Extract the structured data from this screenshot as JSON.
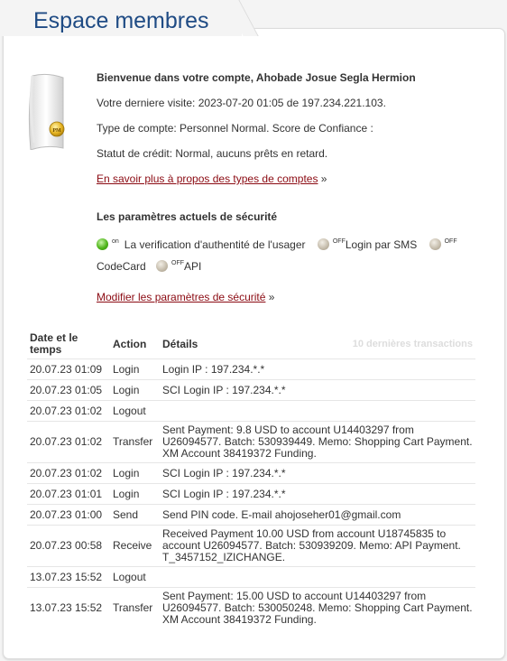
{
  "page": {
    "title": "Espace membres"
  },
  "account": {
    "welcome": "Bienvenue dans votre compte, Ahobade Josue Segla Hermion",
    "last_visit": "Votre derniere visite: 2023-07-20 01:05 de 197.234.221.103.",
    "account_type": "Type de compte: Personnel Normal. Score de Confiance :",
    "credit_status": "Statut de crédit: Normal, aucuns prêts en retard.",
    "learn_more_link": "En savoir plus à propos des types de comptes",
    "learn_more_suffix": " »",
    "badge_text": "PM"
  },
  "security": {
    "heading": "Les paramètres actuels de sécurité",
    "items": [
      {
        "label": "La verification d'authentité de l'usager",
        "state": "on"
      },
      {
        "label": "Login par SMS",
        "state": "OFF"
      },
      {
        "label": "CodeCard",
        "state": "OFF"
      },
      {
        "label": "API",
        "state": "OFF"
      }
    ],
    "modify_link": "Modifier les paramètres de sécurité",
    "modify_suffix": " »",
    "colors": {
      "on": "#4fb51a",
      "off": "#c3baa9"
    }
  },
  "transactions": {
    "headers": {
      "date": "Date et le temps",
      "action": "Action",
      "details": "Détails",
      "count": "10 dernières transactions"
    },
    "rows": [
      {
        "date": "20.07.23 01:09",
        "action": "Login",
        "details": "Login IP : 197.234.*.*"
      },
      {
        "date": "20.07.23 01:05",
        "action": "Login",
        "details": "SCI Login IP : 197.234.*.*"
      },
      {
        "date": "20.07.23 01:02",
        "action": "Logout",
        "details": ""
      },
      {
        "date": "20.07.23 01:02",
        "action": "Transfer",
        "details": "Sent Payment: 9.8 USD to account U14403297 from U26094577. Batch: 530939449. Memo: Shopping Cart Payment. XM Account 38419372 Funding."
      },
      {
        "date": "20.07.23 01:02",
        "action": "Login",
        "details": "SCI Login IP : 197.234.*.*"
      },
      {
        "date": "20.07.23 01:01",
        "action": "Login",
        "details": "SCI Login IP : 197.234.*.*"
      },
      {
        "date": "20.07.23 01:00",
        "action": "Send",
        "details": "Send PIN code. E-mail ahojoseher01@gmail.com"
      },
      {
        "date": "20.07.23 00:58",
        "action": "Receive",
        "details": "Received Payment 10.00 USD from account U18745835 to account U26094577. Batch: 530939209. Memo: API Payment. T_3457152_IZICHANGE."
      },
      {
        "date": "13.07.23 15:52",
        "action": "Logout",
        "details": ""
      },
      {
        "date": "13.07.23 15:52",
        "action": "Transfer",
        "details": "Sent Payment: 15.00 USD to account U14403297 from U26094577. Batch: 530050248. Memo: Shopping Cart Payment. XM Account 38419372 Funding."
      }
    ]
  }
}
